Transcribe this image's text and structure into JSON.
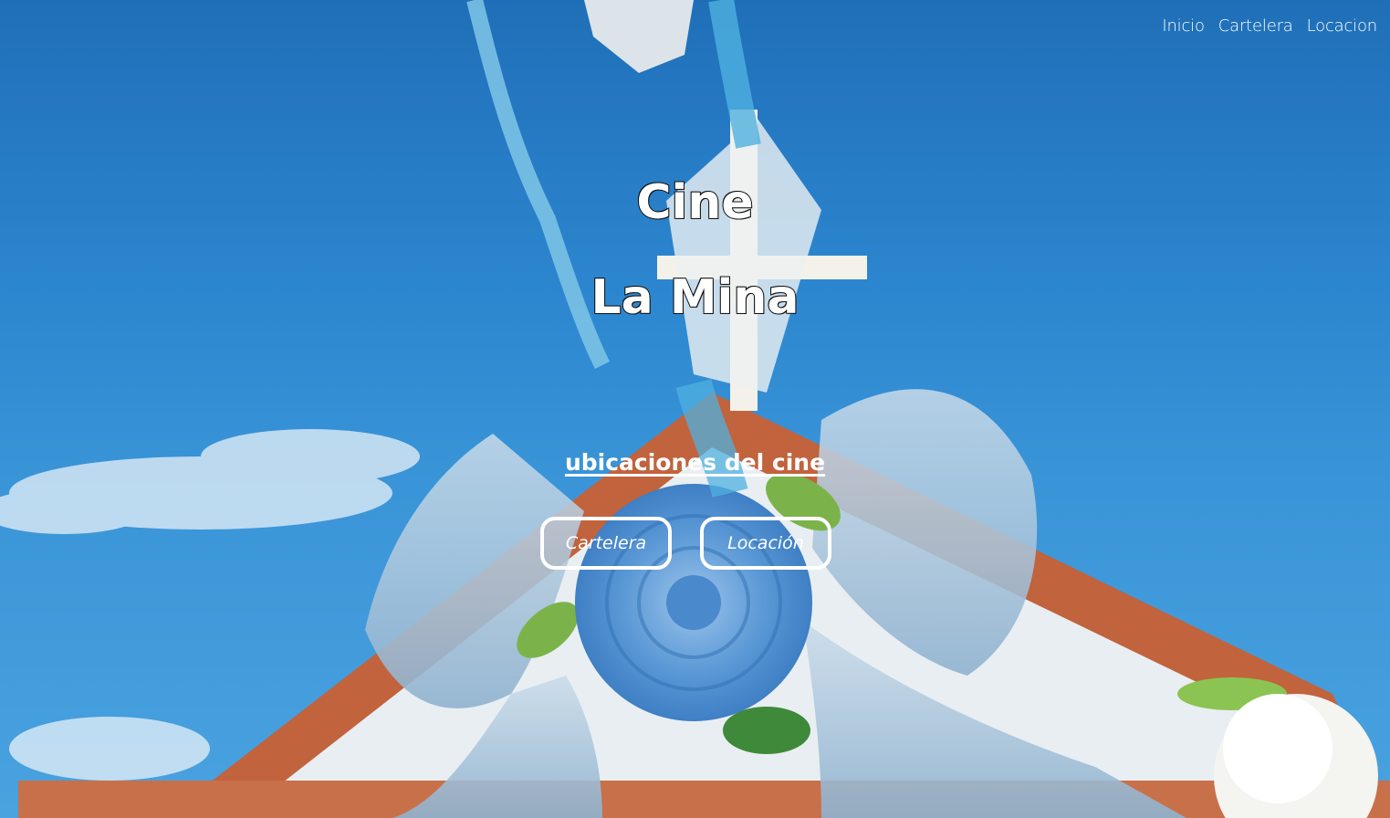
{
  "nav": {
    "items": [
      "Inicio",
      "Cartelera",
      "Locacion"
    ]
  },
  "hero": {
    "title_line1": "Cine",
    "title_line2": "La Mina",
    "link_text": "ubicaciones del cine",
    "buttons": {
      "cartelera": "Cartelera",
      "locacion": "Locación"
    }
  },
  "colors": {
    "sky": "#2c86cf",
    "text": "#ffffff",
    "roof": "#c1633d"
  }
}
